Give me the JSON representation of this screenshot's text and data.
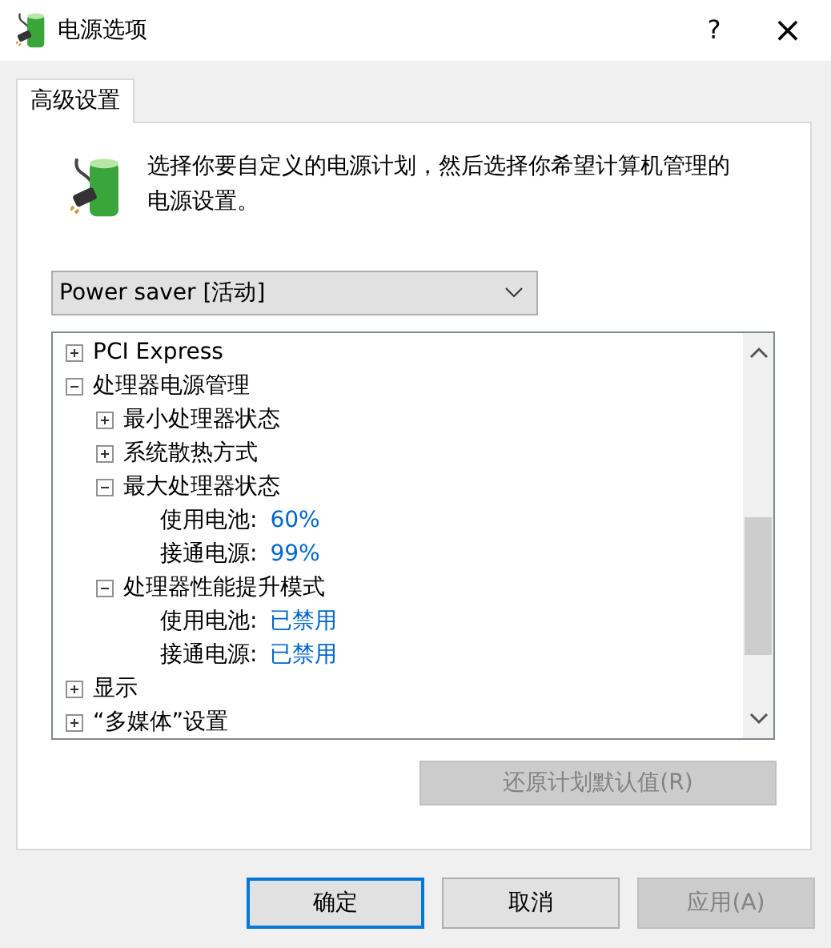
{
  "window": {
    "title": "电源选项",
    "help": "?",
    "close": "×"
  },
  "tabs": [
    {
      "label": "高级设置",
      "selected": true
    }
  ],
  "description": "选择你要自定义的电源计划，然后选择你希望计算机管理的电源设置。",
  "plan_dropdown": {
    "value": "Power saver [活动]"
  },
  "tree": [
    {
      "kind": "group",
      "label": "PCI Express",
      "expanded": false
    },
    {
      "kind": "group",
      "label": "处理器电源管理",
      "expanded": true,
      "children": [
        {
          "kind": "group",
          "label": "最小处理器状态",
          "expanded": false
        },
        {
          "kind": "group",
          "label": "系统散热方式",
          "expanded": false
        },
        {
          "kind": "group",
          "label": "最大处理器状态",
          "expanded": true,
          "children": [
            {
              "kind": "setting",
              "label": "使用电池:",
              "value": "60%"
            },
            {
              "kind": "setting",
              "label": "接通电源:",
              "value": "99%"
            }
          ]
        },
        {
          "kind": "group",
          "label": "处理器性能提升模式",
          "expanded": true,
          "children": [
            {
              "kind": "setting",
              "label": "使用电池:",
              "value": "已禁用"
            },
            {
              "kind": "setting",
              "label": "接通电源:",
              "value": "已禁用"
            }
          ]
        }
      ]
    },
    {
      "kind": "group",
      "label": "显示",
      "expanded": false
    },
    {
      "kind": "group",
      "label": "“多媒体”设置",
      "expanded": false
    }
  ],
  "restore_button": {
    "label": "还原计划默认值(R)",
    "disabled": true
  },
  "buttons": [
    {
      "label": "确定",
      "disabled": false,
      "default": true
    },
    {
      "label": "取消",
      "disabled": false,
      "default": false
    },
    {
      "label": "应用(A)",
      "disabled": true,
      "default": false
    }
  ]
}
